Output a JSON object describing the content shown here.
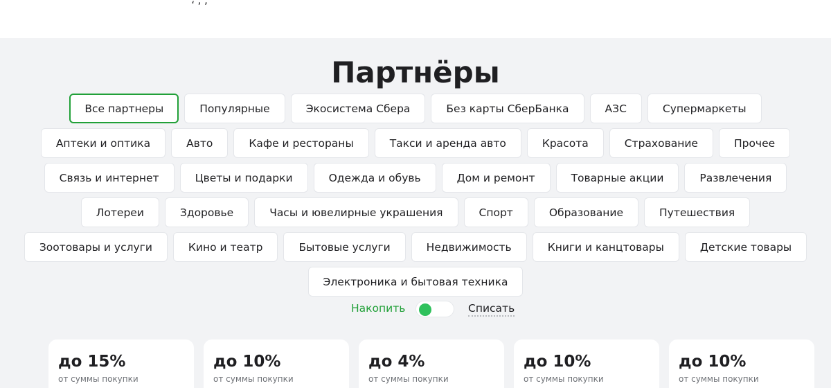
{
  "title": "Партнёры",
  "categories": [
    [
      "Все партнеры",
      "Популярные",
      "Экосистема Сбера",
      "Без карты СберБанка",
      "АЗС",
      "Супермаркеты"
    ],
    [
      "Аптеки и оптика",
      "Авто",
      "Кафе и рестораны",
      "Такси и аренда авто",
      "Красота",
      "Страхование",
      "Прочее"
    ],
    [
      "Связь и интернет",
      "Цветы и подарки",
      "Одежда и обувь",
      "Дом и ремонт",
      "Товарные акции",
      "Развлечения"
    ],
    [
      "Лотереи",
      "Здоровье",
      "Часы и ювелирные украшения",
      "Спорт",
      "Образование",
      "Путешествия"
    ],
    [
      "Зоотовары и услуги",
      "Кино и театр",
      "Бытовые услуги",
      "Недвижимость",
      "Книги и канцтовары",
      "Детские товары"
    ],
    [
      "Электроника и бытовая техника"
    ]
  ],
  "active_category": "Все партнеры",
  "toggle": {
    "left_label": "Накопить",
    "right_label": "Списать",
    "state": "Накопить",
    "accent_color": "#21a038"
  },
  "cards": [
    {
      "percent": "до 15%",
      "subtitle": "от суммы покупки"
    },
    {
      "percent": "до 10%",
      "subtitle": "от суммы покупки"
    },
    {
      "percent": "до 4%",
      "subtitle": "от суммы покупки"
    },
    {
      "percent": "до 10%",
      "subtitle": "от суммы покупки"
    },
    {
      "percent": "до 10%",
      "subtitle": "от суммы покупки"
    }
  ]
}
